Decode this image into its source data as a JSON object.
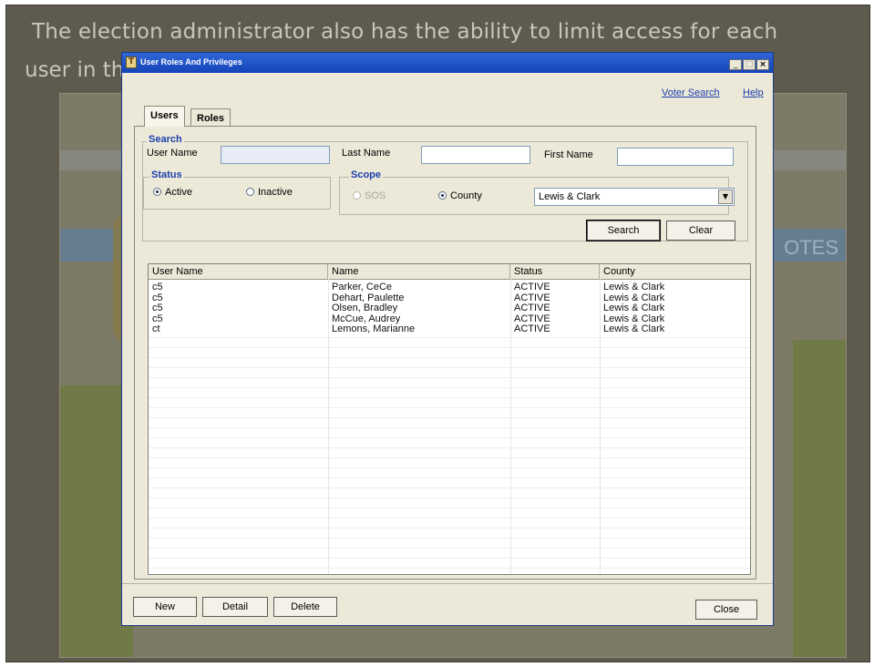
{
  "slide": {
    "caption_line1": "The election administrator also has the ability to limit access for each",
    "caption_line2": "user in th"
  },
  "window": {
    "title": "User Roles And Privileges",
    "links": {
      "voter_search": "Voter Search",
      "help": "Help"
    },
    "tabs": [
      {
        "label": "Users",
        "selected": true
      },
      {
        "label": "Roles",
        "selected": false
      }
    ]
  },
  "search": {
    "group_title": "Search",
    "user_name_label": "User Name",
    "user_name_value": "",
    "last_name_label": "Last Name",
    "last_name_value": "",
    "first_name_label": "First Name",
    "first_name_value": "",
    "status": {
      "title": "Status",
      "active": "Active",
      "inactive": "Inactive",
      "selected": "Active"
    },
    "scope": {
      "title": "Scope",
      "sos": "SOS",
      "county": "County",
      "selected": "County",
      "county_value": "Lewis & Clark"
    },
    "search_button": "Search",
    "clear_button": "Clear"
  },
  "table": {
    "columns": [
      "User Name",
      "Name",
      "Status",
      "County"
    ],
    "rows": [
      {
        "user": "c5",
        "name": "Parker, CeCe",
        "status": "ACTIVE",
        "county": "Lewis & Clark"
      },
      {
        "user": "c5",
        "name": "Dehart, Paulette",
        "status": "ACTIVE",
        "county": "Lewis & Clark"
      },
      {
        "user": "c5",
        "name": "Olsen, Bradley",
        "status": "ACTIVE",
        "county": "Lewis & Clark"
      },
      {
        "user": "c5",
        "name": "McCue, Audrey",
        "status": "ACTIVE",
        "county": "Lewis & Clark"
      },
      {
        "user": "ct",
        "name": "Lemons, Marianne",
        "status": "ACTIVE",
        "county": "Lewis & Clark"
      }
    ]
  },
  "footer": {
    "new": "New",
    "detail": "Detail",
    "delete": "Delete",
    "close": "Close"
  },
  "background_page": {
    "banner_text": "OTES"
  }
}
